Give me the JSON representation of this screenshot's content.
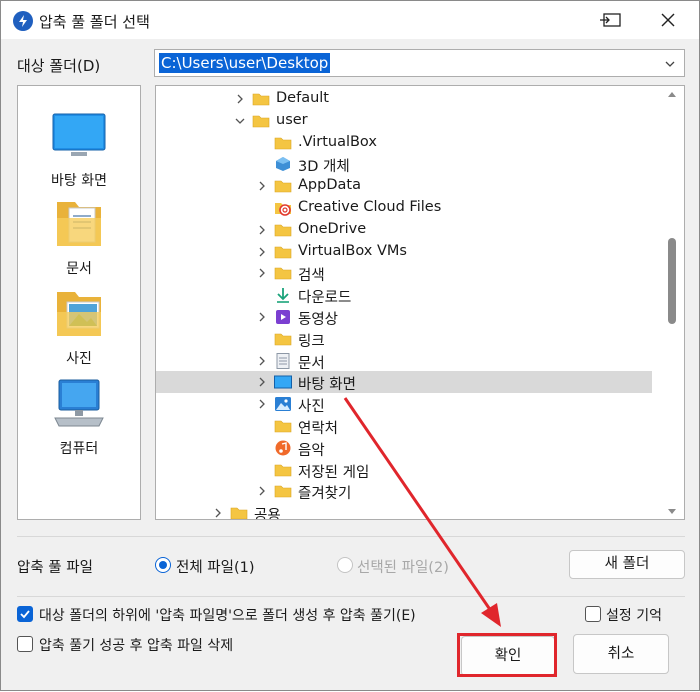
{
  "window": {
    "title": "압축 풀 폴더 선택"
  },
  "path": {
    "label": "대상 폴더(D)",
    "value": "C:\\Users\\user\\Desktop"
  },
  "places": [
    {
      "label": "바탕 화면",
      "icon": "desktop-icon"
    },
    {
      "label": "문서",
      "icon": "documents-icon"
    },
    {
      "label": "사진",
      "icon": "pictures-icon"
    },
    {
      "label": "컴퓨터",
      "icon": "computer-icon"
    }
  ],
  "tree": {
    "items": [
      {
        "label": "Default",
        "icon": "folder-icon",
        "expander": "collapsed"
      },
      {
        "label": "user",
        "icon": "folder-icon",
        "expander": "expanded"
      },
      {
        "label": ".VirtualBox",
        "icon": "folder-icon",
        "expander": "none"
      },
      {
        "label": "3D 개체",
        "icon": "3d-objects-icon",
        "expander": "none"
      },
      {
        "label": "AppData",
        "icon": "folder-icon",
        "expander": "collapsed"
      },
      {
        "label": "Creative Cloud Files",
        "icon": "creative-cloud-icon",
        "expander": "none"
      },
      {
        "label": "OneDrive",
        "icon": "folder-icon",
        "expander": "collapsed"
      },
      {
        "label": "VirtualBox VMs",
        "icon": "folder-icon",
        "expander": "collapsed"
      },
      {
        "label": "검색",
        "icon": "folder-icon",
        "expander": "collapsed"
      },
      {
        "label": "다운로드",
        "icon": "download-icon",
        "expander": "none"
      },
      {
        "label": "동영상",
        "icon": "videos-icon",
        "expander": "collapsed"
      },
      {
        "label": "링크",
        "icon": "folder-icon",
        "expander": "none"
      },
      {
        "label": "문서",
        "icon": "document-icon",
        "expander": "collapsed"
      },
      {
        "label": "바탕 화면",
        "icon": "desktop-icon",
        "expander": "collapsed",
        "selected": true
      },
      {
        "label": "사진",
        "icon": "pictures-icon",
        "expander": "collapsed"
      },
      {
        "label": "연락처",
        "icon": "folder-icon",
        "expander": "none"
      },
      {
        "label": "음악",
        "icon": "music-icon",
        "expander": "none"
      },
      {
        "label": "저장된 게임",
        "icon": "folder-icon",
        "expander": "none"
      },
      {
        "label": "즐겨찾기",
        "icon": "folder-icon",
        "expander": "collapsed"
      },
      {
        "label": "공용",
        "icon": "folder-icon",
        "expander": "collapsed"
      }
    ]
  },
  "extract": {
    "label": "압축 풀 파일",
    "option_all": "전체 파일(1)",
    "option_selected": "선택된 파일(2)",
    "selected_option": "all",
    "new_folder_label": "새 폴더"
  },
  "options": {
    "create_subfolder": "대상 폴더의 하위에 '압축 파일명'으로 폴더 생성 후 압축 풀기(E)",
    "create_subfolder_checked": true,
    "delete_after": "압축 풀기 성공 후 압축 파일 삭제",
    "delete_after_checked": false,
    "remember": "설정 기억",
    "remember_checked": false
  },
  "buttons": {
    "ok_label": "확인",
    "cancel_label": "취소"
  },
  "colors": {
    "accent": "#0a64d6",
    "annotation": "#e0262c",
    "folder": "#f4c542"
  }
}
